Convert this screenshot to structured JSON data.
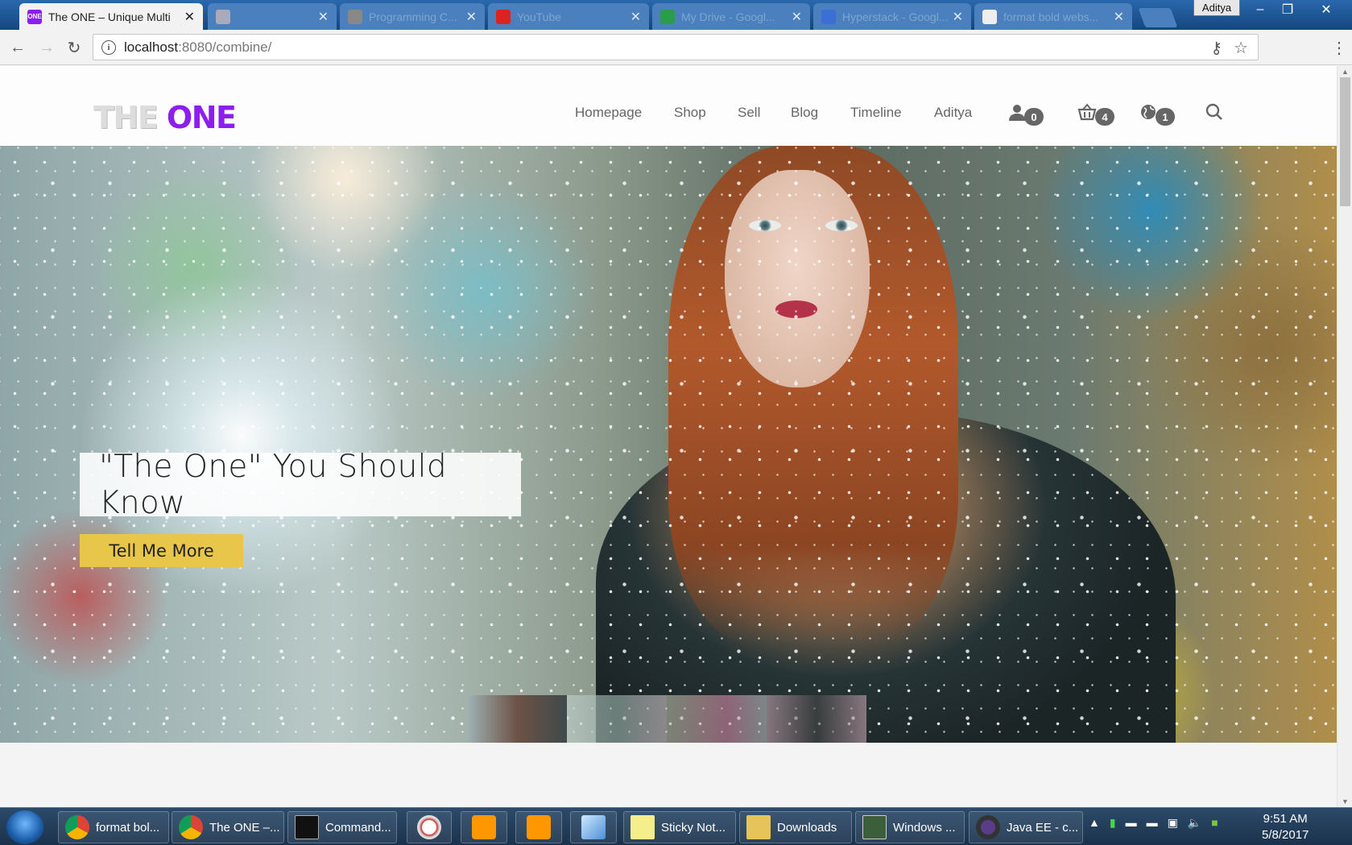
{
  "browser": {
    "tabs": [
      {
        "label": "The ONE – Unique Multi",
        "favicon_text": "ONE",
        "favicon_color": "#8d1ef0",
        "active": true
      },
      {
        "label": "",
        "active": false
      },
      {
        "label": "Programming C...",
        "active": false
      },
      {
        "label": "YouTube",
        "active": false
      },
      {
        "label": "My Drive - Googl...",
        "active": false
      },
      {
        "label": "Hyperstack - Googl...",
        "active": false
      },
      {
        "label": "format bold webs...",
        "active": false
      }
    ],
    "user_chip": "Aditya",
    "url_host": "localhost",
    "url_rest": ":8080/combine/",
    "window_buttons": [
      "–",
      "❐",
      "✕"
    ]
  },
  "site": {
    "logo_part1": "THE",
    "logo_part2": "ONE",
    "nav": [
      {
        "label": "Homepage",
        "id": "homepage"
      },
      {
        "label": "Shop",
        "id": "shop"
      },
      {
        "label": "Sell",
        "id": "sell"
      },
      {
        "label": "Blog",
        "id": "blog"
      },
      {
        "label": "Timeline",
        "id": "timeline"
      },
      {
        "label": "Aditya",
        "id": "user"
      }
    ],
    "badges": {
      "user": "0",
      "cart": "4",
      "globe": "1"
    },
    "hero": {
      "title": "\"The One\" You Should Know",
      "cta": "Tell Me More"
    },
    "accent_color": "#8d1ef0",
    "cta_color": "#e8c64a"
  },
  "taskbar": {
    "items": [
      {
        "label": "format bol...",
        "icon": "chrome-icon"
      },
      {
        "label": "The ONE –...",
        "icon": "chrome-icon"
      },
      {
        "label": "Command...",
        "icon": "cmd-icon"
      },
      {
        "label": "",
        "icon": "compass-icon"
      },
      {
        "label": "",
        "icon": "sublime-icon"
      },
      {
        "label": "",
        "icon": "sublime-icon"
      },
      {
        "label": "",
        "icon": "box-icon"
      },
      {
        "label": "Sticky Not...",
        "icon": "sticky-notes-icon"
      },
      {
        "label": "Downloads",
        "icon": "folder-icon"
      },
      {
        "label": "Windows ...",
        "icon": "windows-explorer-icon"
      },
      {
        "label": "Java EE - c...",
        "icon": "eclipse-icon"
      }
    ],
    "time": "9:51 AM",
    "date": "5/8/2017"
  }
}
